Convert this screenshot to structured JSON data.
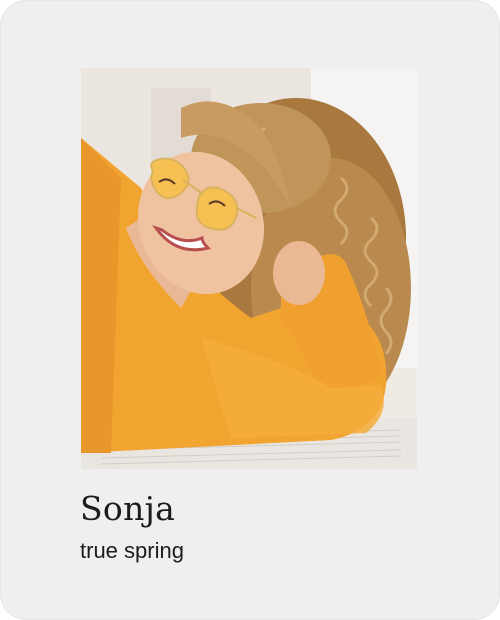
{
  "profile": {
    "name": "Sonja",
    "season": "true spring",
    "photo_subject": "smiling woman with curly blonde hair, yellow heart-shaped sunglasses and an orange sweater"
  },
  "colors": {
    "card_background": "#efefef",
    "sweater": "#f2a431",
    "lens": "#f7c14e",
    "hair": "#b9894e"
  }
}
